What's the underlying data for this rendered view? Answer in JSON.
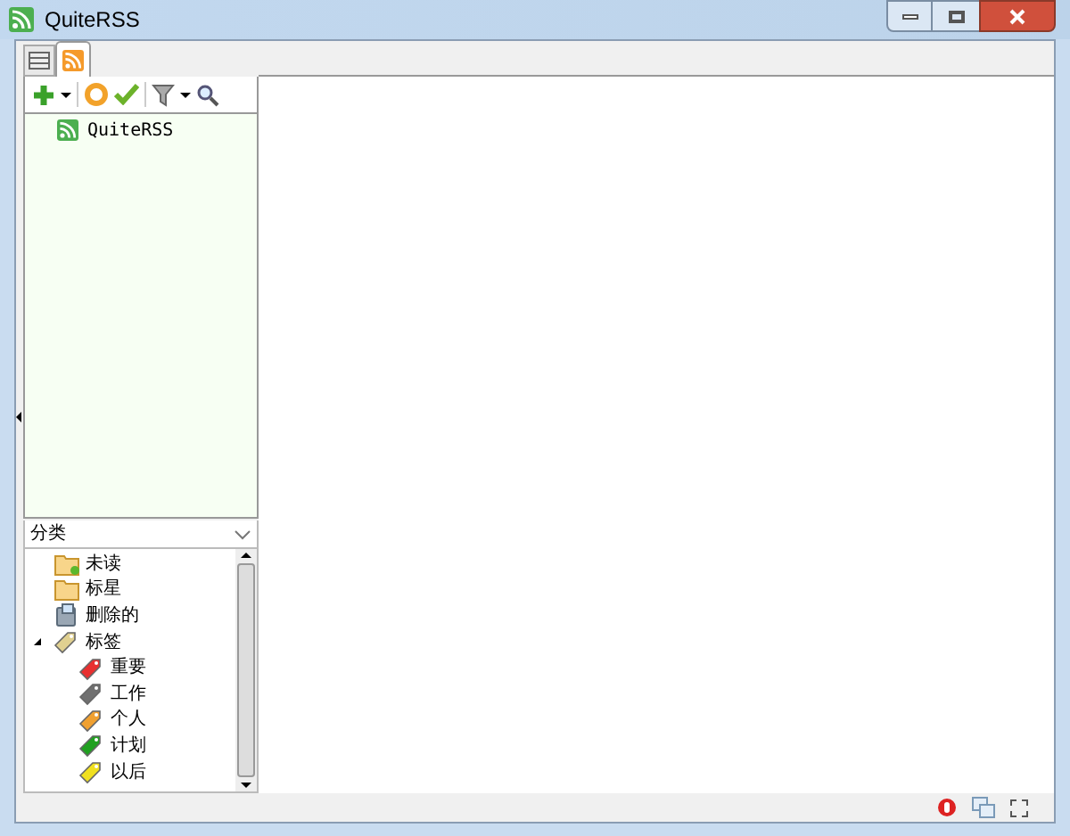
{
  "window": {
    "title": "QuiteRSS"
  },
  "tabs": [
    {
      "kind": "list",
      "selected": false
    },
    {
      "kind": "feed",
      "selected": true
    }
  ],
  "feeds": [
    {
      "title": "QuiteRSS"
    }
  ],
  "categories": {
    "title": "分类",
    "items": [
      {
        "label": "未读",
        "kind": "unread"
      },
      {
        "label": "标星",
        "kind": "starred"
      },
      {
        "label": "删除的",
        "kind": "deleted"
      },
      {
        "label": "标签",
        "kind": "labels",
        "expanded": true,
        "children": [
          {
            "label": "重要",
            "color": "#e83030"
          },
          {
            "label": "工作",
            "color": "#707070"
          },
          {
            "label": "个人",
            "color": "#f0a030"
          },
          {
            "label": "计划",
            "color": "#20a020"
          },
          {
            "label": "以后",
            "color": "#f0e020"
          }
        ]
      }
    ]
  }
}
